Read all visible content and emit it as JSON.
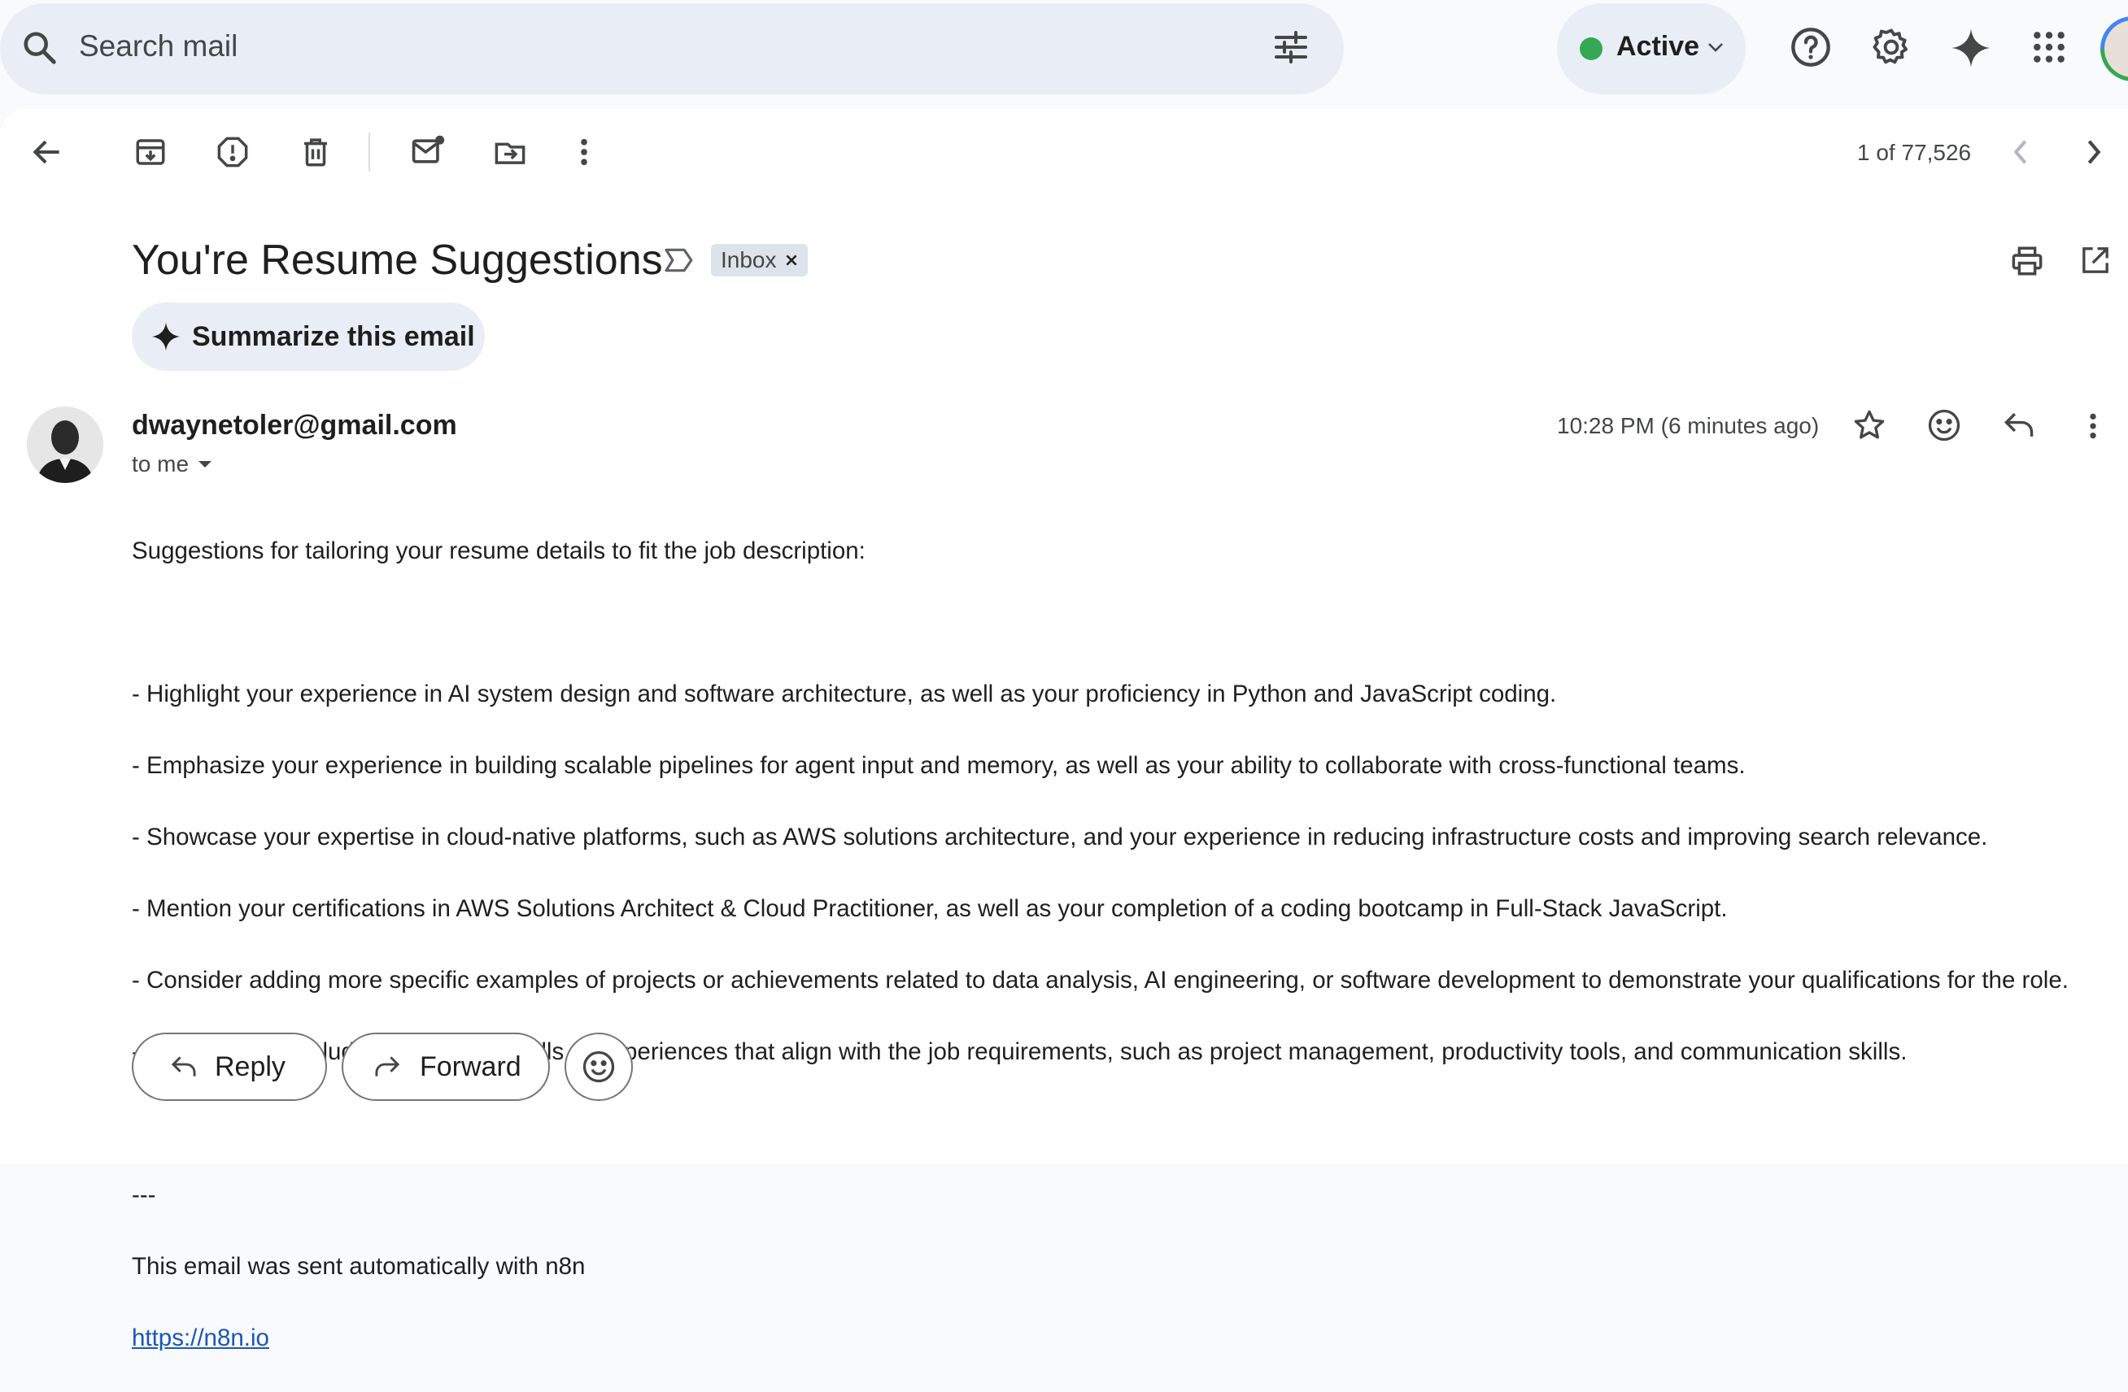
{
  "search": {
    "placeholder": "Search mail"
  },
  "status": {
    "label": "Active",
    "color": "#34a853"
  },
  "toolbar": {
    "page_count": "1 of 77,526"
  },
  "email": {
    "subject": "You're Resume Suggestions",
    "label_chip": "Inbox",
    "summarize_label": "Summarize this email",
    "sender": "dwaynetoler@gmail.com",
    "recipient": "to me",
    "time": "10:28 PM (6 minutes ago)",
    "intro": "Suggestions for tailoring your resume details to fit the job description:",
    "bullets": [
      "- Highlight your experience in AI system design and software architecture, as well as your proficiency in Python and JavaScript coding.",
      "- Emphasize your experience in building scalable pipelines for agent input and memory, as well as your ability to collaborate with cross-functional teams.",
      "- Showcase your expertise in cloud-native platforms, such as AWS solutions architecture, and your experience in reducing infrastructure costs and improving search relevance.",
      "- Mention your certifications in AWS Solutions Architect & Cloud Practitioner, as well as your completion of a coding bootcamp in Full-Stack JavaScript.",
      "- Consider adding more specific examples of projects or achievements related to data analysis, AI engineering, or software development to demonstrate your qualifications for the role.",
      "- Make sure to include any relevant skills or experiences that align with the job requirements, such as project management, productivity tools, and communication skills."
    ],
    "signature_separator": "---",
    "signature_text": "This email was sent automatically with n8n",
    "signature_link": "https://n8n.io"
  },
  "actions": {
    "reply_label": "Reply",
    "forward_label": "Forward"
  },
  "icons": {
    "search": "search-icon",
    "filter": "tune-icon",
    "help": "help-icon",
    "settings": "gear-icon",
    "gemini": "sparkle-icon",
    "apps": "apps-grid-icon",
    "back": "arrow-back-icon",
    "archive": "archive-icon",
    "spam": "report-spam-icon",
    "delete": "trash-icon",
    "unread": "mark-unread-icon",
    "move": "move-to-icon",
    "more": "more-vert-icon",
    "print": "print-icon",
    "open": "open-in-new-icon",
    "star": "star-icon",
    "emoji": "emoji-icon",
    "reply": "reply-icon",
    "forward": "forward-icon"
  }
}
